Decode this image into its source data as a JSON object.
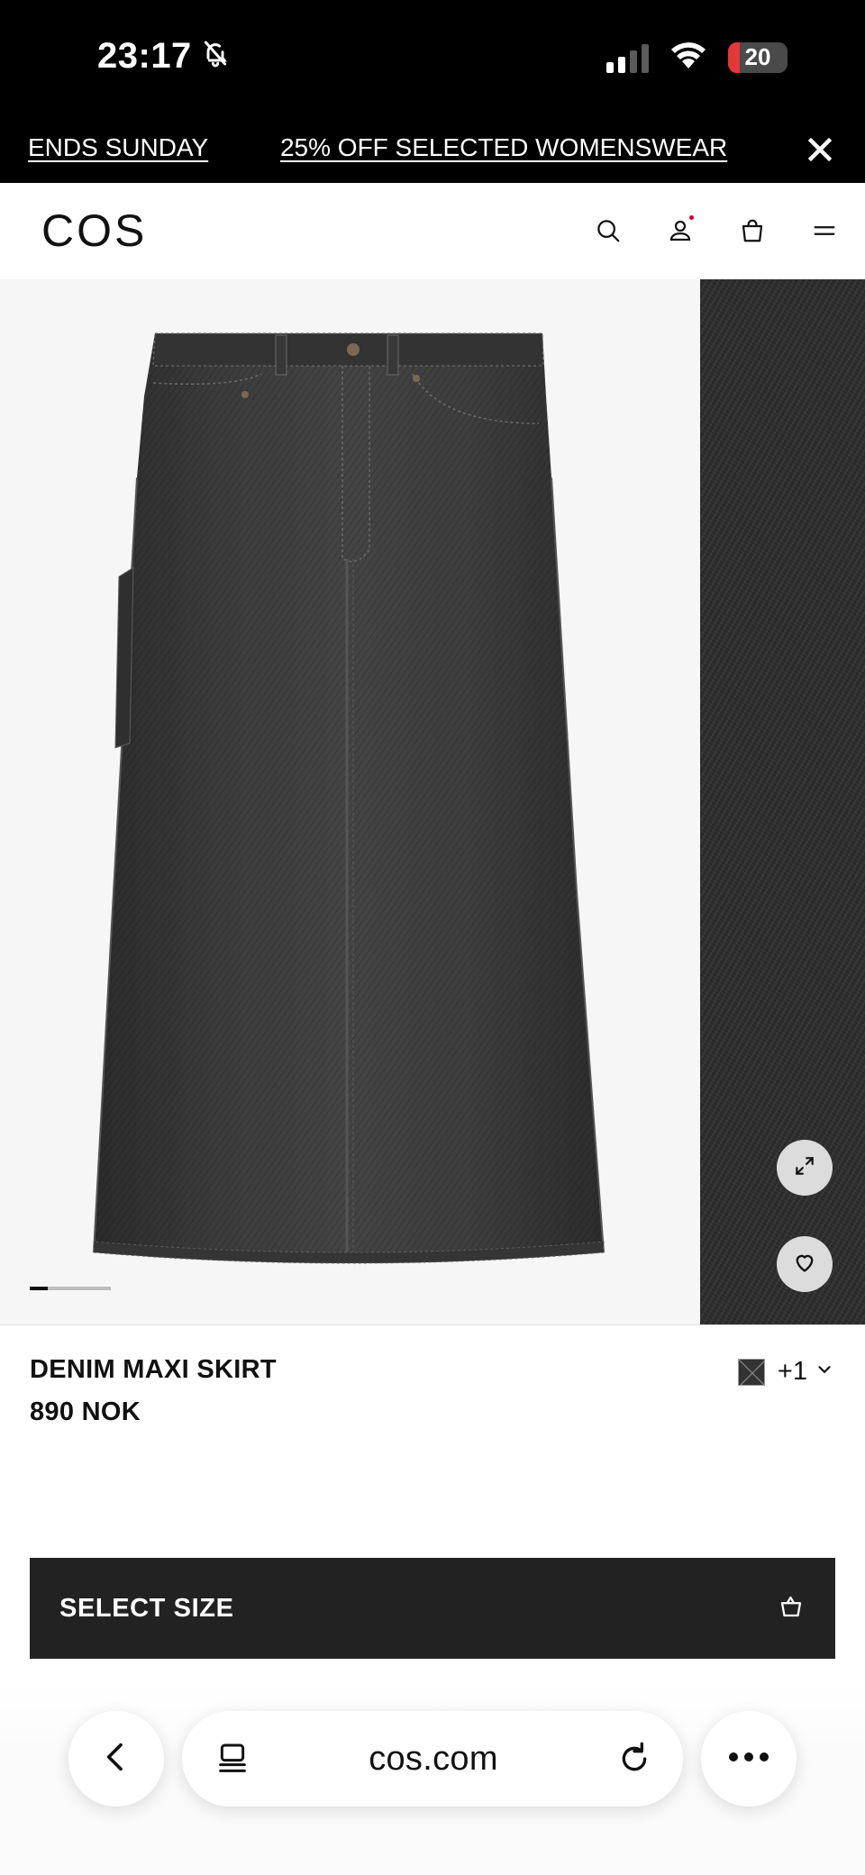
{
  "status_bar": {
    "time": "23:17",
    "battery_level": "20",
    "icons": [
      "bell-slash-icon",
      "cellular-signal-icon",
      "wifi-icon",
      "battery-icon"
    ]
  },
  "promo_banner": {
    "text_partial": "ENDS SUNDAY",
    "text_main": "25% OFF SELECTED WOMENSWEAR",
    "close_icon": "close-icon"
  },
  "header": {
    "logo": "COS",
    "icons": [
      "search-icon",
      "account-icon",
      "shopping-bag-icon",
      "menu-icon"
    ]
  },
  "gallery": {
    "active_slide_fraction": 0.22,
    "expand_icon": "expand-icon",
    "wishlist_icon": "heart-icon"
  },
  "product": {
    "name": "DENIM MAXI SKIRT",
    "price": "890 NOK",
    "more_colors": "+1",
    "swatch_color": "#333333"
  },
  "cta": {
    "select_size_label": "SELECT SIZE",
    "icon": "shopping-bag-icon"
  },
  "browser": {
    "url": "cos.com",
    "icons": [
      "back-icon",
      "tabs-icon",
      "reload-icon",
      "more-icon"
    ]
  },
  "colors": {
    "banner_bg": "#000000",
    "button_bg": "#222222",
    "battery_low": "#e5373a",
    "notification_dot": "#d0021b"
  }
}
